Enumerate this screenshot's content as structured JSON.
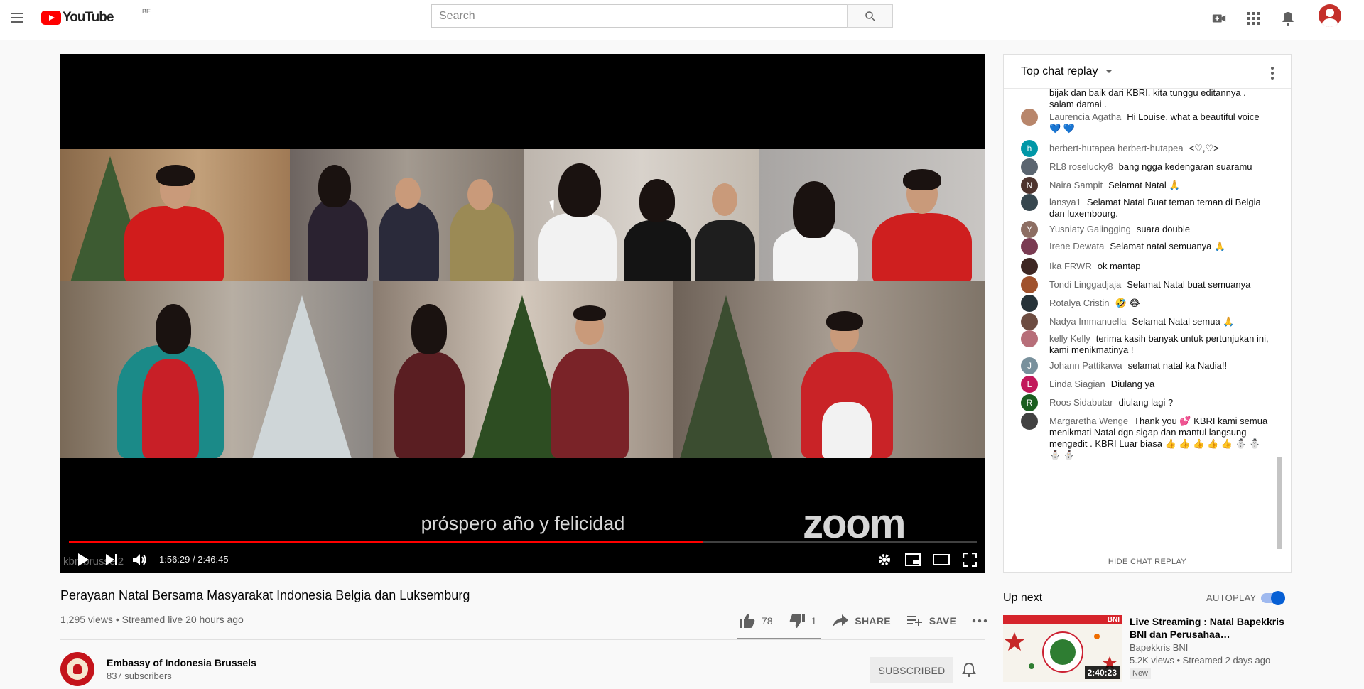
{
  "header": {
    "logo_text": "YouTube",
    "country_code": "BE",
    "search_placeholder": "Search",
    "icons": [
      "menu-icon",
      "search-icon",
      "create-video-icon",
      "apps-icon",
      "notifications-icon",
      "account-avatar"
    ]
  },
  "player": {
    "caption": "próspero año y felicidad",
    "zoom_watermark": "zoom",
    "channel_watermark": "kbri brussel2",
    "current_time": "1:56:29",
    "duration": "2:46:45",
    "time_display": "1:56:29 / 2:46:45",
    "progress_fraction": 0.699,
    "progress_color": "#ff0000"
  },
  "video": {
    "title": "Perayaan Natal Bersama Masyarakat Indonesia Belgia dan Luksemburg",
    "meta": "1,295 views • Streamed live 20 hours ago",
    "likes": "78",
    "dislikes": "1",
    "share_label": "SHARE",
    "save_label": "SAVE"
  },
  "channel": {
    "name": "Embassy of Indonesia Brussels",
    "subscribers": "837 subscribers",
    "subscribe_label": "SUBSCRIBED"
  },
  "chat": {
    "header_label": "Top chat replay",
    "footer_label": "HIDE CHAT REPLAY",
    "messages": [
      {
        "author": "",
        "text": "bijak dan baik dari KBRI. kita tunggu editannya . salam damai .",
        "avatar_letter": "",
        "avatar_color": "#ffffff"
      },
      {
        "author": "Laurencia Agatha",
        "text": "Hi Louise, what a beautiful voice 💙 💙",
        "avatar_letter": "",
        "avatar_color": "#b8866b"
      },
      {
        "author": "herbert-hutapea herbert-hutapea",
        "text": "<♡,♡>",
        "avatar_letter": "h",
        "avatar_color": "#0097a7"
      },
      {
        "author": "RL8 roselucky8",
        "text": "bang ngga kedengaran suaramu",
        "avatar_letter": "",
        "avatar_color": "#5b6570"
      },
      {
        "author": "Naira Sampit",
        "text": "Selamat Natal 🙏",
        "avatar_letter": "N",
        "avatar_color": "#4e342e"
      },
      {
        "author": "lansya1",
        "text": "Selamat Natal Buat teman teman di Belgia dan luxembourg.",
        "avatar_letter": "",
        "avatar_color": "#37474f"
      },
      {
        "author": "Yusniaty Galingging",
        "text": "suara double",
        "avatar_letter": "Y",
        "avatar_color": "#8d6e63"
      },
      {
        "author": "Irene Dewata",
        "text": "Selamat natal semuanya 🙏",
        "avatar_letter": "",
        "avatar_color": "#7a3b52"
      },
      {
        "author": "Ika FRWR",
        "text": "ok mantap",
        "avatar_letter": "",
        "avatar_color": "#3e2723"
      },
      {
        "author": "Tondi Linggadjaja",
        "text": "Selamat Natal buat semuanya",
        "avatar_letter": "",
        "avatar_color": "#a0522d"
      },
      {
        "author": "Rotalya Cristin",
        "text": "🤣 😂",
        "avatar_letter": "",
        "avatar_color": "#263238"
      },
      {
        "author": "Nadya Immanuella",
        "text": "Selamat Natal semua 🙏",
        "avatar_letter": "",
        "avatar_color": "#6d4c41"
      },
      {
        "author": "kelly Kelly",
        "text": "terima kasih banyak untuk pertunjukan ini, kami menikmatinya !",
        "avatar_letter": "",
        "avatar_color": "#b76e79"
      },
      {
        "author": "Johann Pattikawa",
        "text": "selamat natal ka Nadia!!",
        "avatar_letter": "J",
        "avatar_color": "#78909c"
      },
      {
        "author": "Linda Siagian",
        "text": "Diulang ya",
        "avatar_letter": "L",
        "avatar_color": "#c2185b"
      },
      {
        "author": "Roos Sidabutar",
        "text": "diulang lagi ?",
        "avatar_letter": "R",
        "avatar_color": "#1b5e20"
      },
      {
        "author": "Margaretha Wenge",
        "text": "Thank you 💕 KBRI kami semua menikmati Natal dgn sigap dan mantul langsung mengedit . KBRI Luar biasa 👍 👍 👍 👍 👍 ⛄ ⛄ ⛄ ⛄",
        "avatar_letter": "",
        "avatar_color": "#424242"
      }
    ]
  },
  "sidebar": {
    "up_next_label": "Up next",
    "autoplay_label": "AUTOPLAY",
    "autoplay_on": true,
    "video": {
      "title": "Live Streaming : Natal Bapekkris BNI dan Perusahaa…",
      "channel": "Bapekkris BNI",
      "meta": "5.2K views • Streamed 2 days ago",
      "badge": "New",
      "duration": "2:40:23",
      "thumb_logo": "BNI"
    }
  }
}
